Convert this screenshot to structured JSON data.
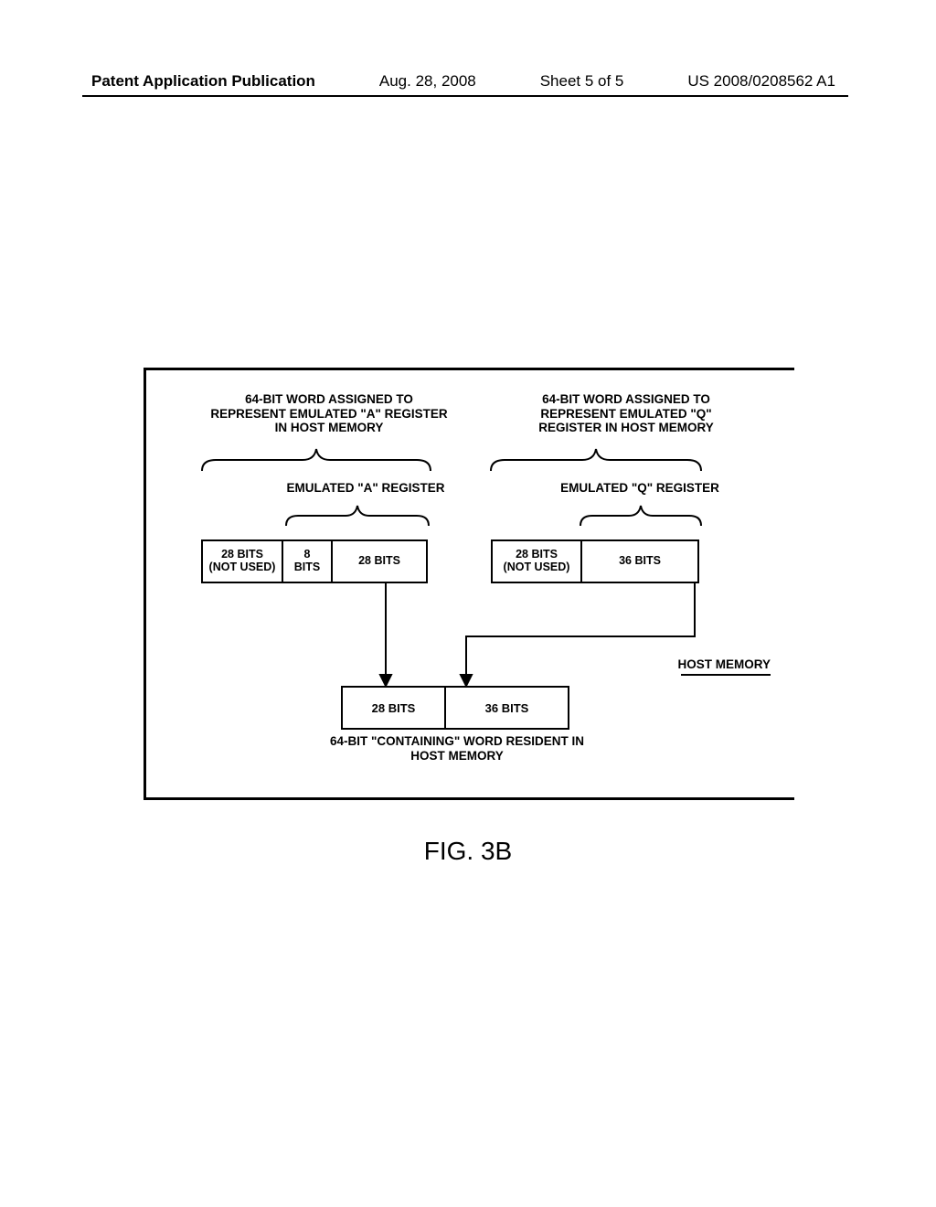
{
  "header": {
    "pub_type": "Patent Application Publication",
    "date": "Aug. 28, 2008",
    "sheet": "Sheet 5 of 5",
    "pub_number": "US 2008/0208562 A1"
  },
  "diagram": {
    "top_left_label": "64-BIT WORD ASSIGNED TO\nREPRESENT EMULATED \"A\"\nREGISTER IN HOST MEMORY",
    "top_right_label": "64-BIT WORD ASSIGNED TO\nREPRESENT EMULATED \"Q\"\nREGISTER IN HOST MEMORY",
    "sub_left_label": "EMULATED \"A\" REGISTER",
    "sub_right_label": "EMULATED \"Q\" REGISTER",
    "reg_a": {
      "c1": "28 BITS\n(NOT USED)",
      "c2": "8\nBITS",
      "c3": "28 BITS"
    },
    "reg_q": {
      "c1": "28 BITS\n(NOT USED)",
      "c2": "36 BITS"
    },
    "host_memory": "HOST MEMORY",
    "containing": {
      "c1": "28 BITS",
      "c2": "36 BITS"
    },
    "bottom_caption": "64-BIT \"CONTAINING\" WORD\nRESIDENT IN HOST MEMORY"
  },
  "figure_label": "FIG. 3B"
}
